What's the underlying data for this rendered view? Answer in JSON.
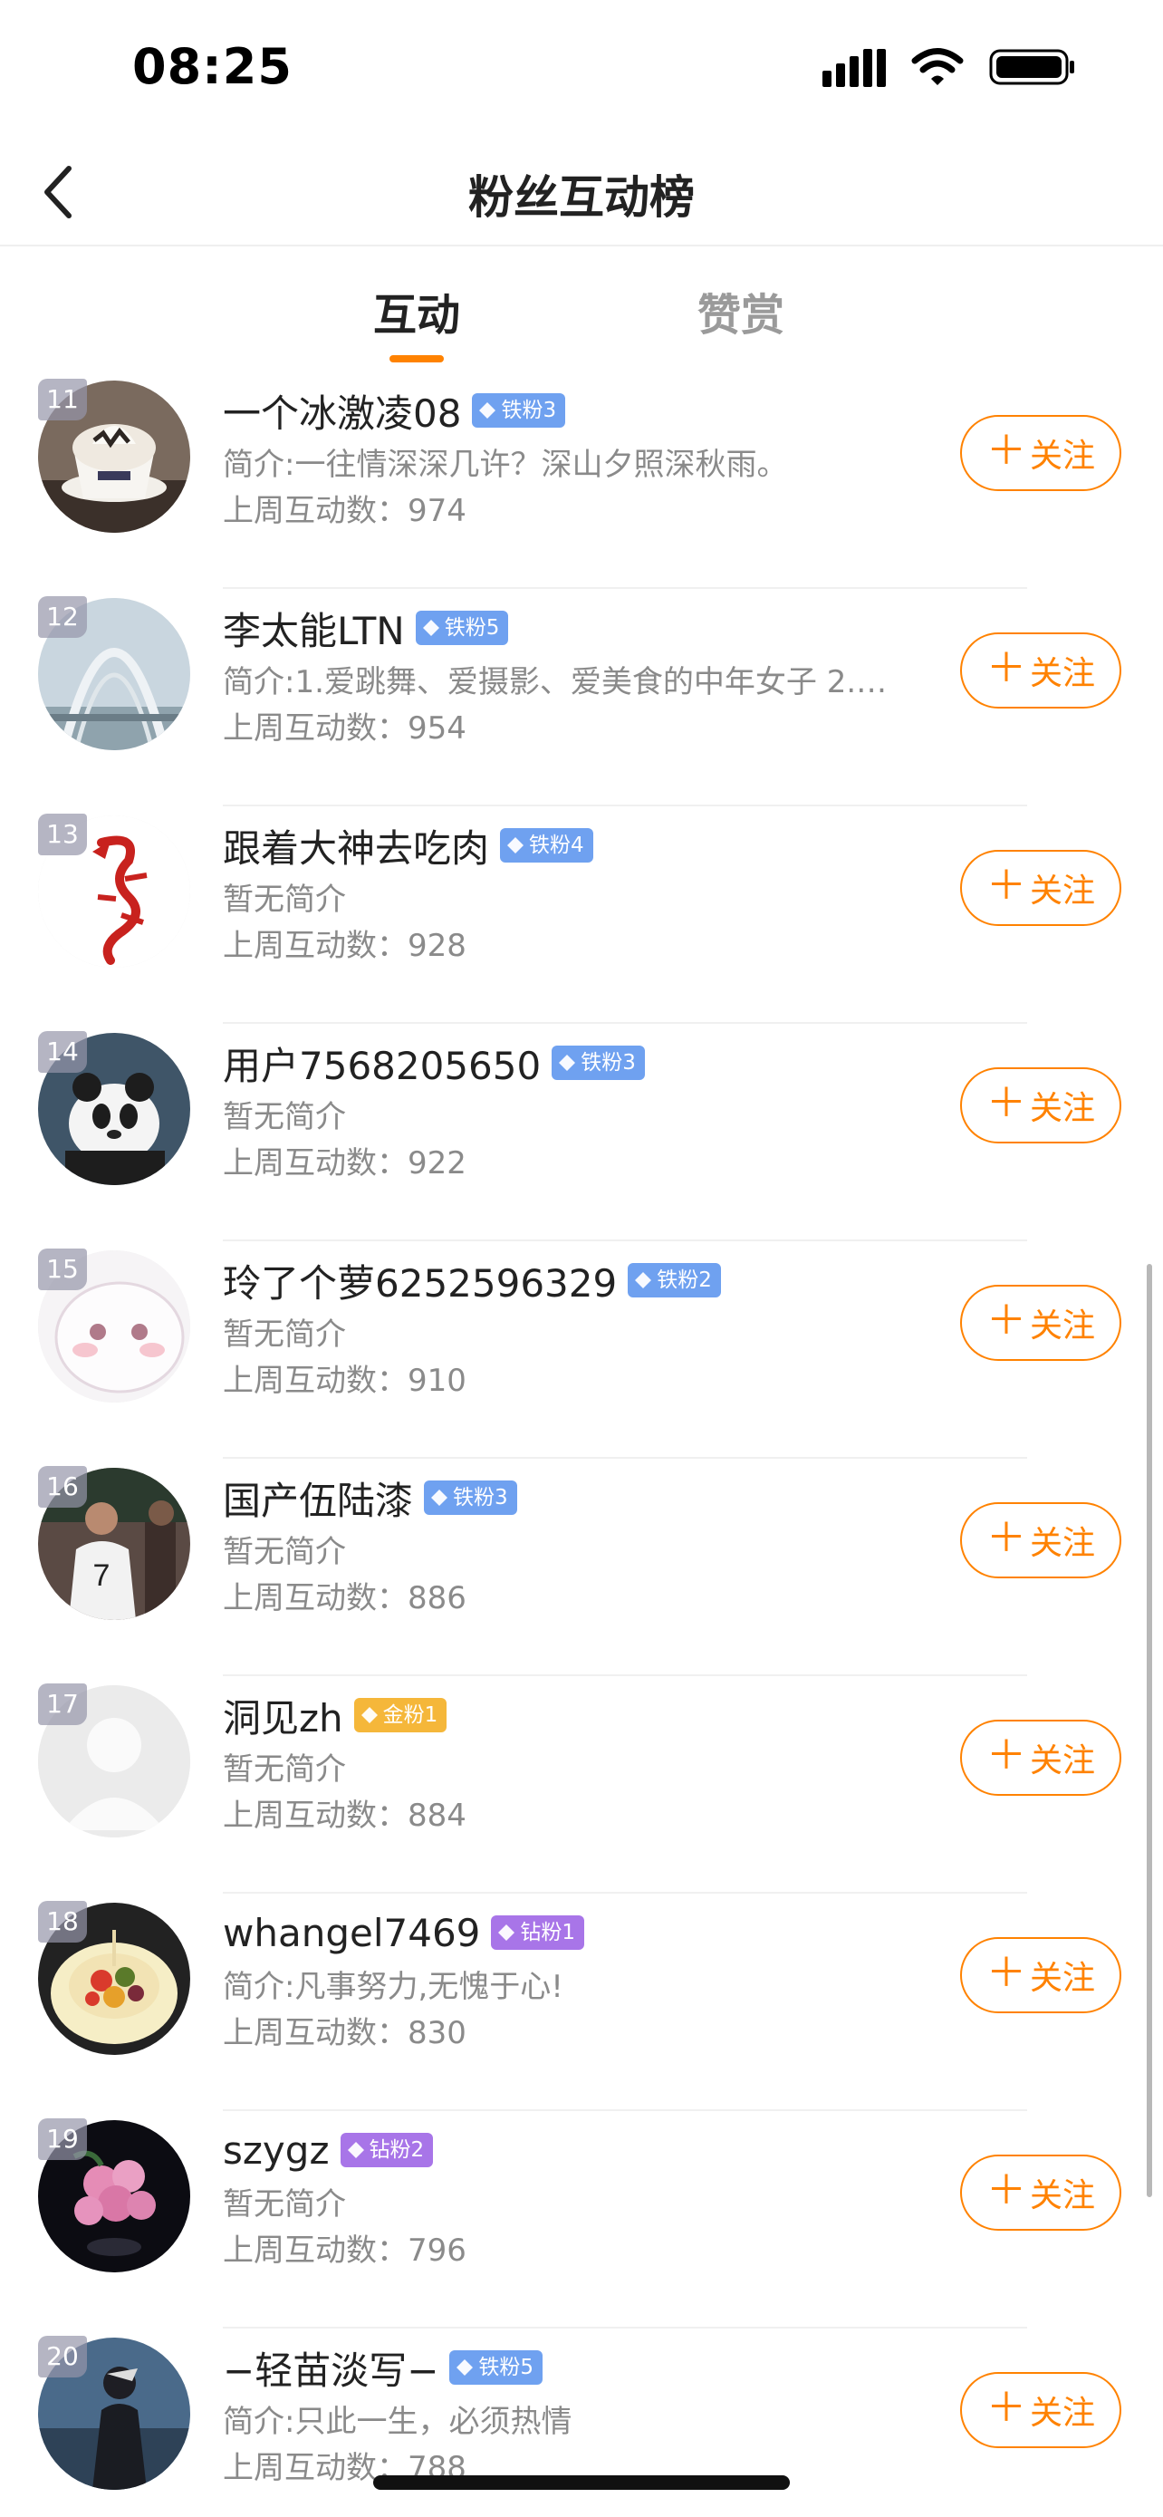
{
  "status": {
    "time": "08:25"
  },
  "nav": {
    "title": "粉丝互动榜"
  },
  "tabs": [
    {
      "label": "互动",
      "active": true
    },
    {
      "label": "赞赏",
      "active": false
    }
  ],
  "colors": {
    "accent": "#ff8200",
    "iron_badge": "#6fa1f0",
    "gold_badge": "#f5b73a",
    "diamond_badge": "#a875e8"
  },
  "users": [
    {
      "rank": "11",
      "name": "一个冰激凌08",
      "badge": "铁粉3",
      "badge_type": "iron",
      "bio": "简介:一往情深深几许？深山夕照深秋雨。",
      "count": "上周互动数：974",
      "follow": "关注",
      "avatar": "coffee"
    },
    {
      "rank": "12",
      "name": "李太能LTN",
      "badge": "铁粉5",
      "badge_type": "iron",
      "bio": "简介:1.爱跳舞、爱摄影、爱美食的中年女子 2.…",
      "count": "上周互动数：954",
      "follow": "关注",
      "avatar": "arch"
    },
    {
      "rank": "13",
      "name": "跟着大神去吃肉",
      "badge": "铁粉4",
      "badge_type": "iron",
      "bio": "暂无简介",
      "count": "上周互动数：928",
      "follow": "关注",
      "avatar": "dragon"
    },
    {
      "rank": "14",
      "name": "用户7568205650",
      "badge": "铁粉3",
      "badge_type": "iron",
      "bio": "暂无简介",
      "count": "上周互动数：922",
      "follow": "关注",
      "avatar": "panda"
    },
    {
      "rank": "15",
      "name": "玲了个萝6252596329",
      "badge": "铁粉2",
      "badge_type": "iron",
      "bio": "暂无简介",
      "count": "上周互动数：910",
      "follow": "关注",
      "avatar": "cartoon"
    },
    {
      "rank": "16",
      "name": "国产伍陆漆",
      "badge": "铁粉3",
      "badge_type": "iron",
      "bio": "暂无简介",
      "count": "上周互动数：886",
      "follow": "关注",
      "avatar": "player"
    },
    {
      "rank": "17",
      "name": "洞见zh",
      "badge": "金粉1",
      "badge_type": "gold",
      "bio": "暂无简介",
      "count": "上周互动数：884",
      "follow": "关注",
      "avatar": "default"
    },
    {
      "rank": "18",
      "name": "whangel7469",
      "badge": "钻粉1",
      "badge_type": "diamond",
      "bio": "简介:凡事努力,无愧于心!",
      "count": "上周互动数：830",
      "follow": "关注",
      "avatar": "cake"
    },
    {
      "rank": "19",
      "name": "szygz",
      "badge": "钻粉2",
      "badge_type": "diamond",
      "bio": "暂无简介",
      "count": "上周互动数：796",
      "follow": "关注",
      "avatar": "roses"
    },
    {
      "rank": "20",
      "name": "−轻苗淡写−",
      "badge": "铁粉5",
      "badge_type": "iron",
      "bio": "简介:只此一生，必须热情",
      "count": "上周互动数：788",
      "follow": "关注",
      "avatar": "figure"
    }
  ]
}
